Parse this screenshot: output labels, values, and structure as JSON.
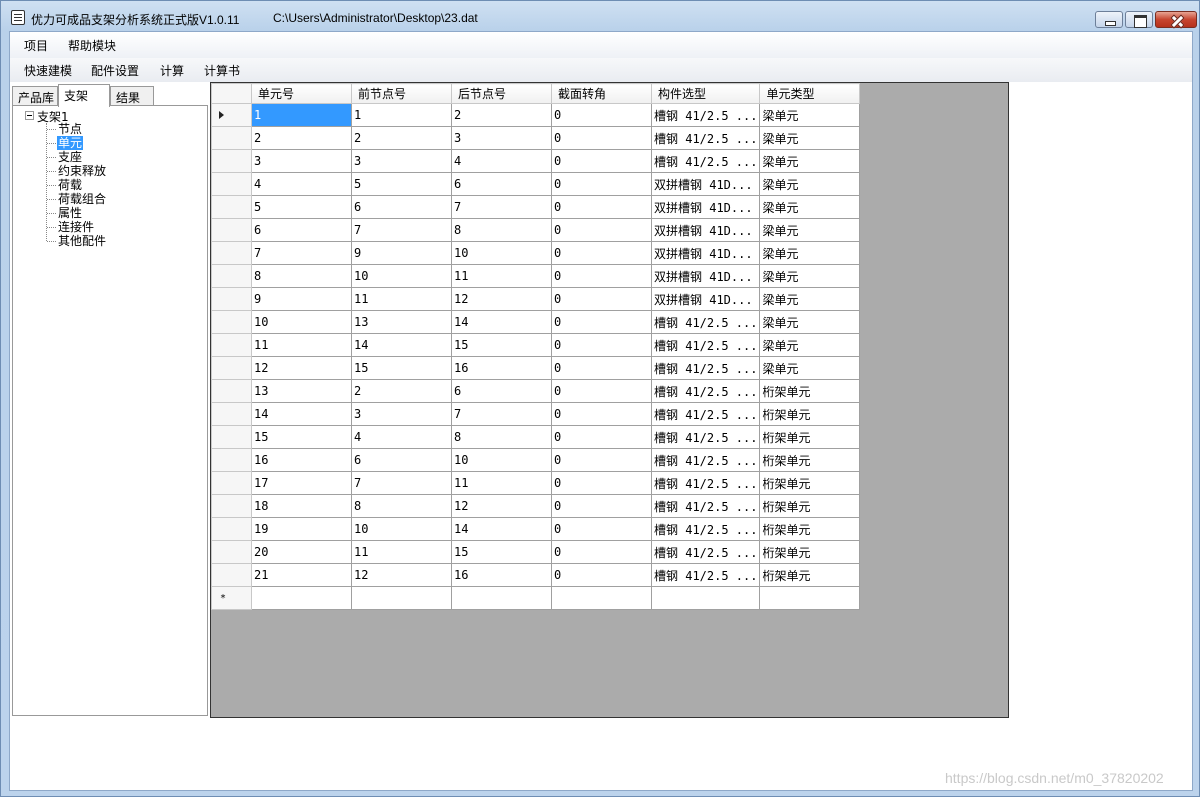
{
  "window": {
    "title": "优力可成品支架分析系统正式版V1.0.11",
    "file_path": "C:\\Users\\Administrator\\Desktop\\23.dat"
  },
  "menu": [
    "项目",
    "帮助模块"
  ],
  "toolbar": [
    "快速建模",
    "配件设置",
    "计算",
    "计算书"
  ],
  "tabs": [
    "产品库",
    "支架",
    "结果"
  ],
  "active_tab": "支架",
  "tree": {
    "root": "支架1",
    "items": [
      "节点",
      "单元",
      "支座",
      "约束释放",
      "荷载",
      "荷载组合",
      "属性",
      "连接件",
      "其他配件"
    ],
    "selected": "单元"
  },
  "grid": {
    "columns": [
      "单元号",
      "前节点号",
      "后节点号",
      "截面转角",
      "构件选型",
      "单元类型"
    ],
    "rows": [
      [
        "1",
        "1",
        "2",
        "0",
        "槽钢 41/2.5 ...",
        "梁单元"
      ],
      [
        "2",
        "2",
        "3",
        "0",
        "槽钢 41/2.5 ...",
        "梁单元"
      ],
      [
        "3",
        "3",
        "4",
        "0",
        "槽钢 41/2.5 ...",
        "梁单元"
      ],
      [
        "4",
        "5",
        "6",
        "0",
        "双拼槽钢 41D...",
        "梁单元"
      ],
      [
        "5",
        "6",
        "7",
        "0",
        "双拼槽钢 41D...",
        "梁单元"
      ],
      [
        "6",
        "7",
        "8",
        "0",
        "双拼槽钢 41D...",
        "梁单元"
      ],
      [
        "7",
        "9",
        "10",
        "0",
        "双拼槽钢 41D...",
        "梁单元"
      ],
      [
        "8",
        "10",
        "11",
        "0",
        "双拼槽钢 41D...",
        "梁单元"
      ],
      [
        "9",
        "11",
        "12",
        "0",
        "双拼槽钢 41D...",
        "梁单元"
      ],
      [
        "10",
        "13",
        "14",
        "0",
        "槽钢 41/2.5 ...",
        "梁单元"
      ],
      [
        "11",
        "14",
        "15",
        "0",
        "槽钢 41/2.5 ...",
        "梁单元"
      ],
      [
        "12",
        "15",
        "16",
        "0",
        "槽钢 41/2.5 ...",
        "梁单元"
      ],
      [
        "13",
        "2",
        "6",
        "0",
        "槽钢 41/2.5 ...",
        "桁架单元"
      ],
      [
        "14",
        "3",
        "7",
        "0",
        "槽钢 41/2.5 ...",
        "桁架单元"
      ],
      [
        "15",
        "4",
        "8",
        "0",
        "槽钢 41/2.5 ...",
        "桁架单元"
      ],
      [
        "16",
        "6",
        "10",
        "0",
        "槽钢 41/2.5 ...",
        "桁架单元"
      ],
      [
        "17",
        "7",
        "11",
        "0",
        "槽钢 41/2.5 ...",
        "桁架单元"
      ],
      [
        "18",
        "8",
        "12",
        "0",
        "槽钢 41/2.5 ...",
        "桁架单元"
      ],
      [
        "19",
        "10",
        "14",
        "0",
        "槽钢 41/2.5 ...",
        "桁架单元"
      ],
      [
        "20",
        "11",
        "15",
        "0",
        "槽钢 41/2.5 ...",
        "桁架单元"
      ],
      [
        "21",
        "12",
        "16",
        "0",
        "槽钢 41/2.5 ...",
        "桁架单元"
      ]
    ],
    "new_row_marker": "*"
  },
  "watermark": "https://blog.csdn.net/m0_37820202"
}
